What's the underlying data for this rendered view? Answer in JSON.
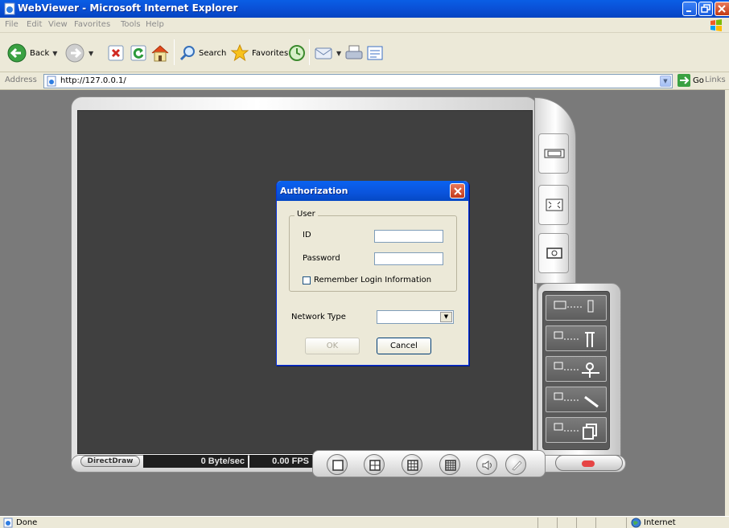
{
  "window": {
    "title": "WebViewer - Microsoft Internet Explorer"
  },
  "menu": [
    "File",
    "Edit",
    "View",
    "Favorites",
    "Tools",
    "Help"
  ],
  "toolbar": {
    "back_label": "Back",
    "search_label": "Search",
    "favorites_label": "Favorites"
  },
  "address": {
    "label": "Address",
    "url": "http://127.0.0.1/",
    "go_label": "Go",
    "links_label": "Links"
  },
  "status": {
    "text": "Done",
    "zone": "Internet"
  },
  "viewer": {
    "render_mode": "DirectDraw",
    "bitrate": "0 Byte/sec",
    "fps": "0.00 FPS"
  },
  "dialog": {
    "title": "Authorization",
    "group_label": "User",
    "id_label": "ID",
    "id_value": "",
    "password_label": "Password",
    "password_value": "",
    "remember_label": "Remember Login Information",
    "remember_checked": false,
    "network_type_label": "Network Type",
    "network_type_value": "",
    "ok_label": "OK",
    "cancel_label": "Cancel"
  },
  "colors": {
    "xp_blue": "#0a54dc",
    "dialog_bg": "#ece9d8",
    "video_bg": "#404040",
    "record": "#e64545"
  }
}
